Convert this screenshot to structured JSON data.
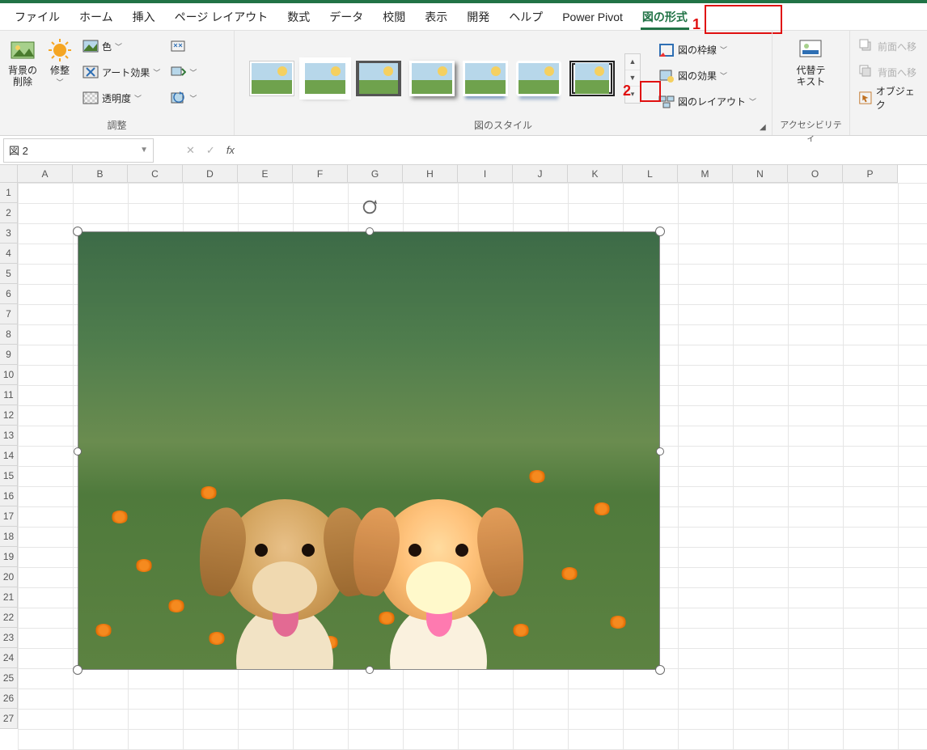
{
  "tabs": {
    "file": "ファイル",
    "home": "ホーム",
    "insert": "挿入",
    "pagelayout": "ページ レイアウト",
    "formulas": "数式",
    "data": "データ",
    "review": "校閲",
    "view": "表示",
    "developer": "開発",
    "help": "ヘルプ",
    "powerpivot": "Power Pivot",
    "pictureformat": "図の形式"
  },
  "ribbon": {
    "removebg": "背景の\n削除",
    "corrections": "修整",
    "color": "色",
    "artistic": "アート効果",
    "transparency": "透明度",
    "group_adjust": "調整",
    "group_styles": "図のスタイル",
    "border": "図の枠線",
    "effects": "図の効果",
    "layout": "図のレイアウト",
    "alttext": "代替テ\nキスト",
    "group_access": "アクセシビリティ",
    "front": "前面へ移",
    "back": "背面へ移",
    "selection": "オブジェク"
  },
  "annotations": {
    "a1": "1",
    "a2": "2"
  },
  "namebox": {
    "value": "図 2"
  },
  "fx": {
    "symbol": "fx"
  },
  "columns": [
    "A",
    "B",
    "C",
    "D",
    "E",
    "F",
    "G",
    "H",
    "I",
    "J",
    "K",
    "L",
    "M",
    "N",
    "O",
    "P"
  ],
  "rowcount": 27,
  "image": {
    "description": "Two golden retriever puppies sitting on grass with orange flowers, green blurred background",
    "selected": true
  }
}
